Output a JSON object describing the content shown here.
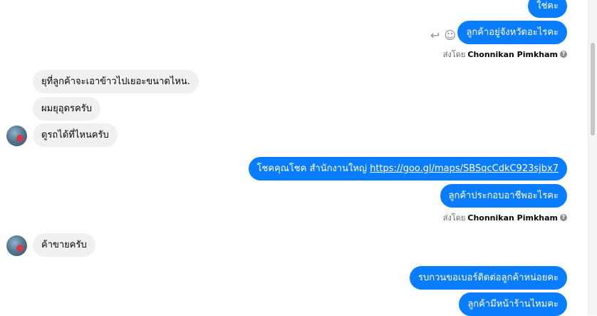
{
  "messages": {
    "out_1": "ใช่คะ",
    "out_2": "ลูกค้าอยู่จังหวัดอะไรคะ",
    "in_1": "ยุที่ลูกค้าจะเอาข้าวไปเยอะขนาดไหน.",
    "in_2": "ผมยุอุดรครับ",
    "in_3": "ดูรถได้ที่ไหนครับ",
    "out_3_text": "โชคคุณโชค สำนักงานใหญ่ ",
    "out_3_link": "https://goo.gl/maps/SBSqcCdkC923sjbx7",
    "out_4": "ลูกค้าประกอบอาชีพอะไรคะ",
    "in_4": "ค้าขายครับ",
    "out_5": "รบกวนขอเบอร์ติดต่อลูกค้าหน่อยคะ",
    "out_6": "ลูกค้ามีหน้าร้านไหมคะ"
  },
  "sent_by": {
    "prefix": "ส่งโดย",
    "name": "Chonnikan Pimkham",
    "info": "?"
  },
  "icons": {
    "reply": "↩",
    "emoji": "☺"
  }
}
